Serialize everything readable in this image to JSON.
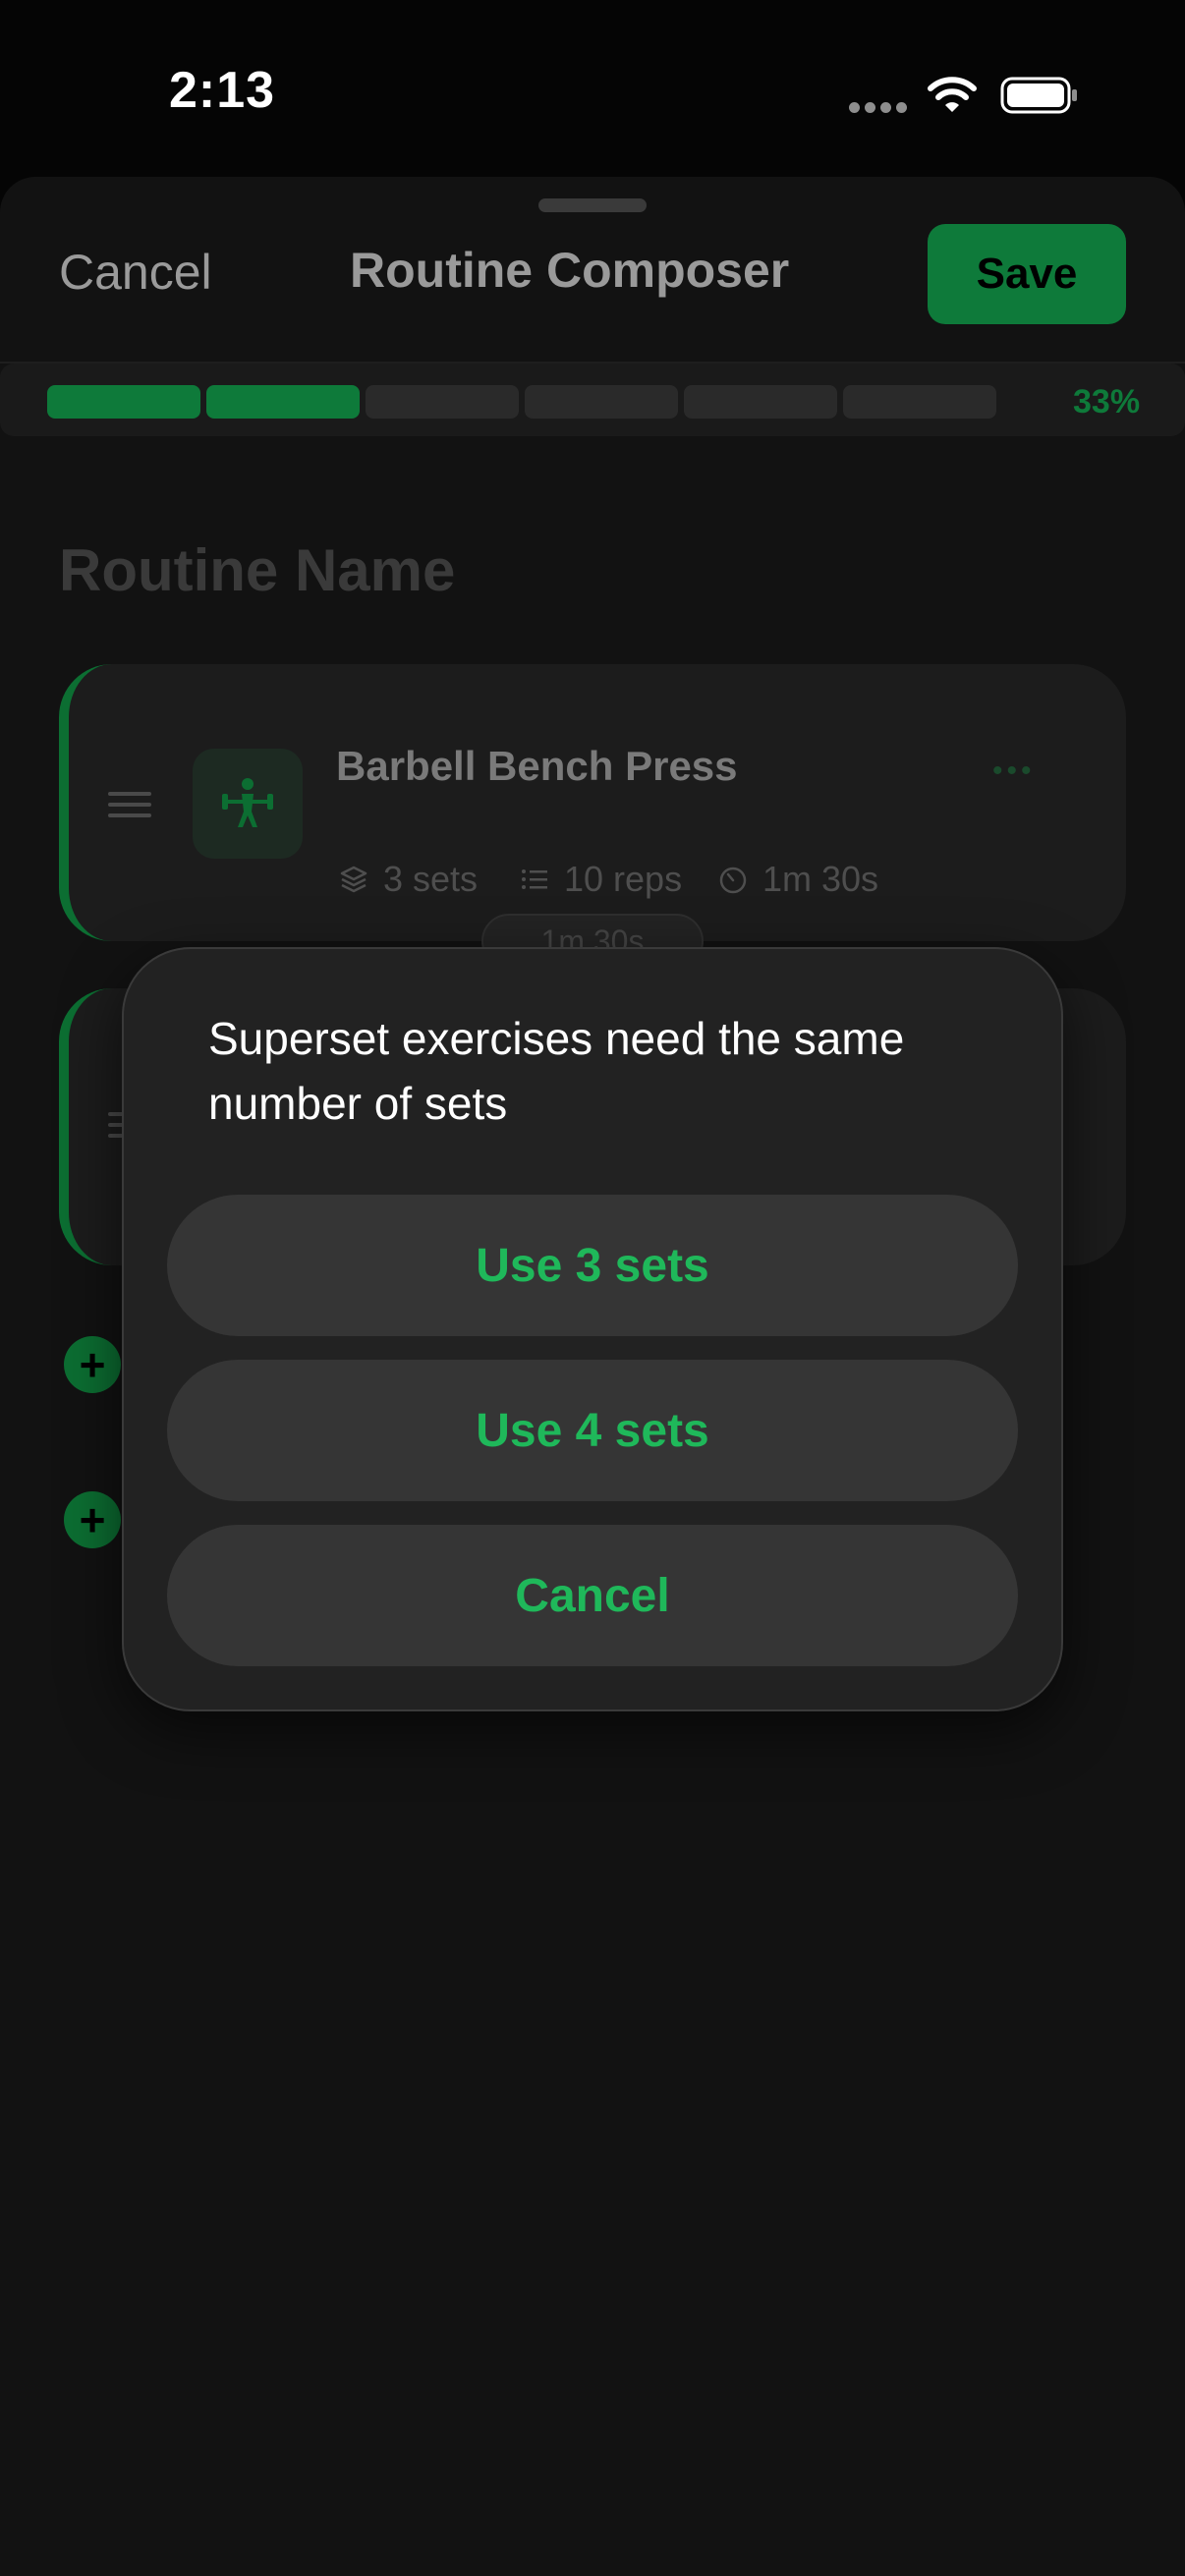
{
  "status_bar": {
    "time": "2:13"
  },
  "nav": {
    "cancel_label": "Cancel",
    "title": "Routine Composer",
    "save_label": "Save"
  },
  "progress": {
    "filled_segments": 2,
    "total_segments": 6,
    "percent_label": "33%"
  },
  "routine": {
    "name_placeholder": "Routine Name"
  },
  "exercise": {
    "title": "Barbell Bench Press",
    "sets": "3 sets",
    "reps": "10 reps",
    "rest": "1m 30s",
    "rest_chip": "1m 30s"
  },
  "dialog": {
    "message": "Superset exercises need the same number of sets",
    "option_1": "Use 3 sets",
    "option_2": "Use 4 sets",
    "cancel": "Cancel"
  },
  "colors": {
    "accent": "#1fb85a",
    "accent_dark": "#0e7a3a",
    "background": "#050505"
  }
}
